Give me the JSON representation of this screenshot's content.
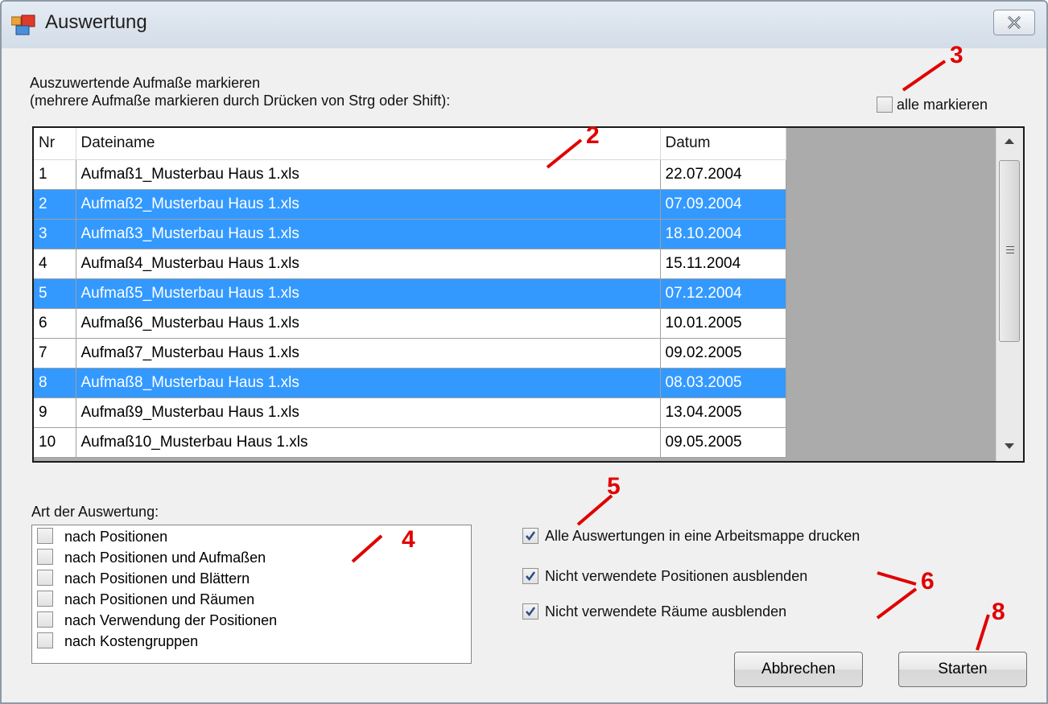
{
  "window": {
    "title": "Auswertung"
  },
  "selection": {
    "instruction_line1": "Auszuwertende Aufmaße markieren",
    "instruction_line2": "(mehrere Aufmaße markieren durch Drücken von Strg oder Shift):",
    "select_all_label": "alle markieren",
    "select_all_checked": false
  },
  "grid": {
    "columns": [
      "Nr",
      "Dateiname",
      "Datum"
    ],
    "rows": [
      {
        "nr": "1",
        "name": "Aufmaß1_Musterbau Haus 1.xls",
        "date": "22.07.2004",
        "selected": false
      },
      {
        "nr": "2",
        "name": "Aufmaß2_Musterbau Haus 1.xls",
        "date": "07.09.2004",
        "selected": true
      },
      {
        "nr": "3",
        "name": "Aufmaß3_Musterbau Haus 1.xls",
        "date": "18.10.2004",
        "selected": true
      },
      {
        "nr": "4",
        "name": "Aufmaß4_Musterbau Haus 1.xls",
        "date": "15.11.2004",
        "selected": false
      },
      {
        "nr": "5",
        "name": "Aufmaß5_Musterbau Haus 1.xls",
        "date": "07.12.2004",
        "selected": true
      },
      {
        "nr": "6",
        "name": "Aufmaß6_Musterbau Haus 1.xls",
        "date": "10.01.2005",
        "selected": false
      },
      {
        "nr": "7",
        "name": "Aufmaß7_Musterbau Haus 1.xls",
        "date": "09.02.2005",
        "selected": false
      },
      {
        "nr": "8",
        "name": "Aufmaß8_Musterbau Haus 1.xls",
        "date": "08.03.2005",
        "selected": true
      },
      {
        "nr": "9",
        "name": "Aufmaß9_Musterbau Haus 1.xls",
        "date": "13.04.2005",
        "selected": false
      },
      {
        "nr": "10",
        "name": "Aufmaß10_Musterbau Haus 1.xls",
        "date": "09.05.2005",
        "selected": false
      }
    ]
  },
  "evaluation": {
    "label": "Art der Auswertung:",
    "options": [
      {
        "label": "nach Positionen",
        "checked": false
      },
      {
        "label": "nach Positionen und Aufmaßen",
        "checked": false
      },
      {
        "label": "nach Positionen und Blättern",
        "checked": false
      },
      {
        "label": "nach Positionen und Räumen",
        "checked": false
      },
      {
        "label": "nach Verwendung der Positionen",
        "checked": false
      },
      {
        "label": "nach Kostengruppen",
        "checked": false
      }
    ]
  },
  "options": [
    {
      "label": "Alle Auswertungen in eine Arbeitsmappe drucken",
      "checked": true
    },
    {
      "label": "Nicht verwendete Positionen ausblenden",
      "checked": true
    },
    {
      "label": "Nicht verwendete Räume ausblenden",
      "checked": true
    }
  ],
  "buttons": {
    "cancel": "Abbrechen",
    "start": "Starten"
  },
  "annotations": [
    "3",
    "2",
    "4",
    "5",
    "6",
    "8"
  ],
  "colors": {
    "selection": "#3399ff",
    "annotation": "#e00000"
  }
}
